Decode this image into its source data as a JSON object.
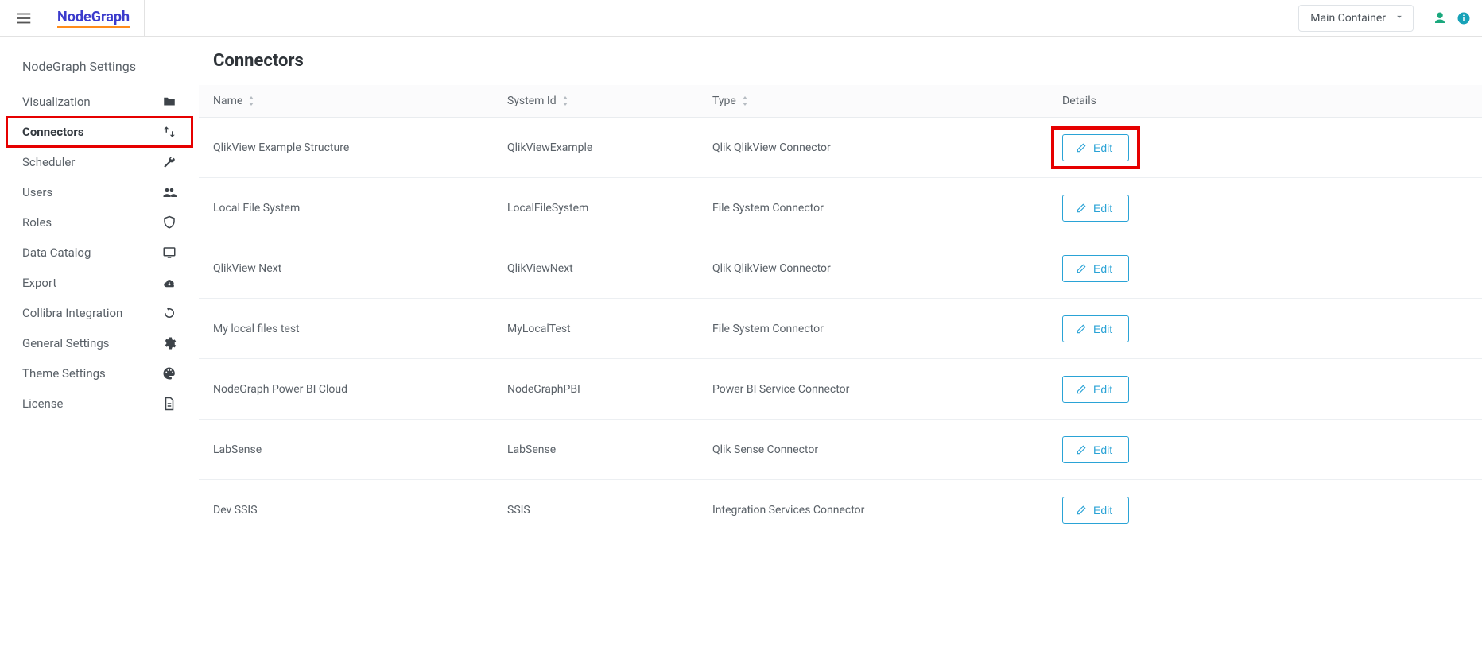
{
  "header": {
    "brand": "NodeGraph",
    "container_label": "Main Container"
  },
  "sidebar": {
    "title": "NodeGraph Settings",
    "items": [
      {
        "label": "Visualization",
        "icon": "folder-icon"
      },
      {
        "label": "Connectors",
        "icon": "swap-icon",
        "active": true
      },
      {
        "label": "Scheduler",
        "icon": "wrench-icon"
      },
      {
        "label": "Users",
        "icon": "users-icon"
      },
      {
        "label": "Roles",
        "icon": "shield-icon"
      },
      {
        "label": "Data Catalog",
        "icon": "monitor-icon"
      },
      {
        "label": "Export",
        "icon": "cloud-download-icon"
      },
      {
        "label": "Collibra Integration",
        "icon": "sync-icon"
      },
      {
        "label": "General Settings",
        "icon": "gear-icon"
      },
      {
        "label": "Theme Settings",
        "icon": "palette-icon"
      },
      {
        "label": "License",
        "icon": "document-icon"
      }
    ]
  },
  "page": {
    "title": "Connectors",
    "columns": {
      "name": "Name",
      "system": "System Id",
      "type": "Type",
      "details": "Details"
    },
    "edit_label": "Edit",
    "rows": [
      {
        "name": "QlikView Example Structure",
        "system": "QlikViewExample",
        "type": "Qlik QlikView Connector",
        "highlight": true
      },
      {
        "name": "Local File System",
        "system": "LocalFileSystem",
        "type": "File System Connector"
      },
      {
        "name": "QlikView Next",
        "system": "QlikViewNext",
        "type": "Qlik QlikView Connector"
      },
      {
        "name": "My local files test",
        "system": "MyLocalTest",
        "type": "File System Connector"
      },
      {
        "name": "NodeGraph Power BI Cloud",
        "system": "NodeGraphPBI",
        "type": "Power BI Service Connector"
      },
      {
        "name": "LabSense",
        "system": "LabSense",
        "type": "Qlik Sense Connector"
      },
      {
        "name": "Dev SSIS",
        "system": "SSIS",
        "type": "Integration Services Connector"
      }
    ]
  }
}
